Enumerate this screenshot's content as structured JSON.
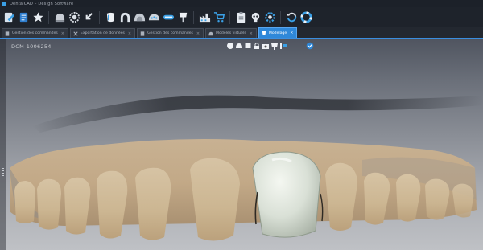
{
  "window": {
    "title": "DentalCAD – Design Software"
  },
  "toolbar": {
    "buttons": [
      "edit-icon",
      "notes-icon",
      "star-icon",
      "dome-icon",
      "gear-wheel-icon",
      "export-icon",
      "tooth-icon",
      "arch-icon",
      "model-dome-icon",
      "upper-jaw-icon",
      "bar-icon",
      "single-tooth-icon",
      "factory-icon",
      "cart-icon",
      "clipboard-icon",
      "skull-icon",
      "settings-icon",
      "refresh-icon",
      "lifebuoy-icon"
    ],
    "accent": "#3aa0e6"
  },
  "tabs": [
    {
      "label": "Gestion des commandes",
      "close": "×",
      "active": false
    },
    {
      "label": "Exportation de données",
      "close": "×",
      "active": false
    },
    {
      "label": "Gestion des commandes",
      "close": "×",
      "active": false
    },
    {
      "label": "Modèles virtuels",
      "close": "×",
      "active": false
    },
    {
      "label": "Modelage",
      "close": "×",
      "active": true
    }
  ],
  "viewport": {
    "case_id": "DCM-1006254",
    "view_tools": [
      "front-view-icon",
      "top-view-icon",
      "left-view-icon",
      "lock-icon",
      "camera-icon",
      "model-icon",
      "align-icon"
    ],
    "confirm_icon": "check-circle-icon"
  }
}
